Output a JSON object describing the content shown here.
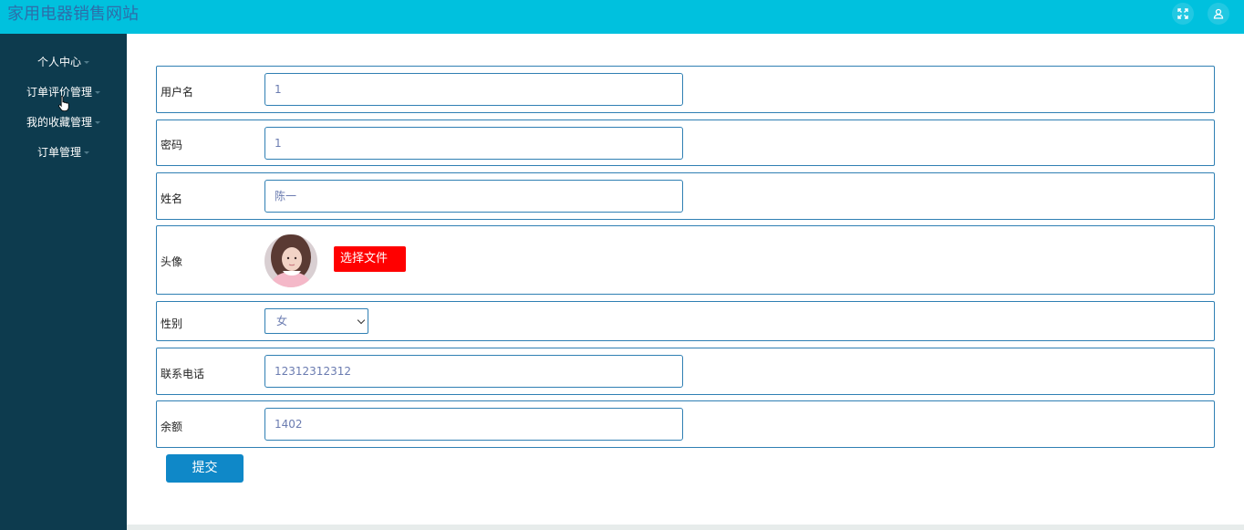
{
  "header": {
    "app_title": "家用电器销售网站",
    "fullscreen_icon": "fullscreen-icon",
    "user_icon": "user-icon"
  },
  "sidebar": {
    "items": [
      {
        "label": "个人中心"
      },
      {
        "label": "订单评价管理"
      },
      {
        "label": "我的收藏管理"
      },
      {
        "label": "订单管理"
      }
    ]
  },
  "form": {
    "username": {
      "label": "用户名",
      "value": "1"
    },
    "password": {
      "label": "密码",
      "value": "1"
    },
    "name": {
      "label": "姓名",
      "value": "陈一"
    },
    "avatar": {
      "label": "头像",
      "button_label": "选择文件"
    },
    "gender": {
      "label": "性别",
      "selected": "女"
    },
    "phone": {
      "label": "联系电话",
      "value": "12312312312"
    },
    "balance": {
      "label": "余额",
      "value": "1402"
    },
    "submit_label": "提交"
  },
  "colors": {
    "topbar": "#00c1de",
    "sidebar": "#0d3b4e",
    "border": "#2f7fb3",
    "file_button": "#ff0000",
    "submit_button": "#0f88c8"
  }
}
